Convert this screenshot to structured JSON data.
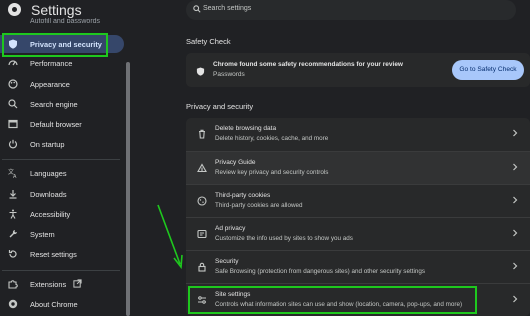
{
  "app": {
    "title": "Settings"
  },
  "search": {
    "placeholder": "Search settings"
  },
  "sidebar": {
    "cut_item": "Autofill and passwords",
    "items": [
      {
        "label": "Privacy and security",
        "icon": "shield-icon",
        "active": true
      },
      {
        "label": "Performance",
        "icon": "gauge-icon"
      },
      {
        "label": "Appearance",
        "icon": "palette-icon"
      },
      {
        "label": "Search engine",
        "icon": "search-icon"
      },
      {
        "label": "Default browser",
        "icon": "browser-icon"
      },
      {
        "label": "On startup",
        "icon": "power-icon"
      },
      {
        "label": "Languages",
        "icon": "translate-icon"
      },
      {
        "label": "Downloads",
        "icon": "download-icon"
      },
      {
        "label": "Accessibility",
        "icon": "accessibility-icon"
      },
      {
        "label": "System",
        "icon": "wrench-icon"
      },
      {
        "label": "Reset settings",
        "icon": "reset-icon"
      },
      {
        "label": "Extensions",
        "icon": "puzzle-icon"
      },
      {
        "label": "About Chrome",
        "icon": "chrome-icon"
      }
    ]
  },
  "safety_check": {
    "heading": "Safety Check",
    "title": "Chrome found some safety recommendations for your review",
    "subtitle": "Passwords",
    "button": "Go to Safety Check"
  },
  "privacy": {
    "heading": "Privacy and security",
    "rows": [
      {
        "title": "Delete browsing data",
        "subtitle": "Delete history, cookies, cache, and more",
        "icon": "trash-icon"
      },
      {
        "title": "Privacy Guide",
        "subtitle": "Review key privacy and security controls",
        "icon": "privacy-guide-icon"
      },
      {
        "title": "Third-party cookies",
        "subtitle": "Third-party cookies are allowed",
        "icon": "cookie-icon"
      },
      {
        "title": "Ad privacy",
        "subtitle": "Customize the info used by sites to show you ads",
        "icon": "ad-privacy-icon"
      },
      {
        "title": "Security",
        "subtitle": "Safe Browsing (protection from dangerous sites) and other security settings",
        "icon": "lock-icon"
      },
      {
        "title": "Site settings",
        "subtitle": "Controls what information sites can use and show (location, camera, pop-ups, and more)",
        "icon": "sliders-icon"
      }
    ]
  },
  "colors": {
    "highlight": "#1ec81e",
    "accent": "#a8c7fa",
    "active_nav": "#36476a"
  }
}
